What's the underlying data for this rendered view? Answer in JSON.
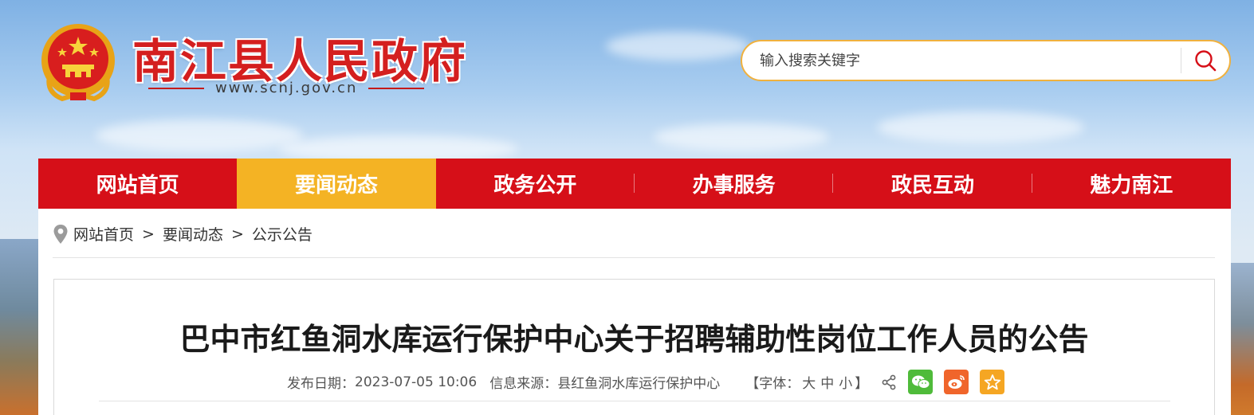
{
  "header": {
    "site_title": "南江县人民政府",
    "site_url": "www.scnj.gov.cn",
    "search_placeholder": "输入搜索关键字"
  },
  "nav": {
    "items": [
      {
        "label": "网站首页",
        "active": false
      },
      {
        "label": "要闻动态",
        "active": true
      },
      {
        "label": "政务公开",
        "active": false
      },
      {
        "label": "办事服务",
        "active": false
      },
      {
        "label": "政民互动",
        "active": false
      },
      {
        "label": "魅力南江",
        "active": false
      }
    ]
  },
  "breadcrumb": {
    "items": [
      "网站首页",
      "要闻动态",
      "公示公告"
    ],
    "separator": ">"
  },
  "article": {
    "title": "巴中市红鱼洞水库运行保护中心关于招聘辅助性岗位工作人员的公告",
    "date_label": "发布日期：",
    "date_value": "2023-07-05 10:06",
    "source_label": "信息来源：",
    "source_value": "县红鱼洞水库运行保护中心",
    "font_label": "【字体：",
    "font_large": "大",
    "font_medium": "中",
    "font_small": "小",
    "font_close": "】"
  },
  "colors": {
    "nav_bg": "#d60f18",
    "nav_active": "#f4b324",
    "title_red": "#d41f1f",
    "search_border": "#f0b13e"
  },
  "icons": {
    "breadcrumb": "location-pin-icon",
    "search": "search-icon",
    "share": "share-icon",
    "wechat": "wechat-icon",
    "weibo": "weibo-icon",
    "favorite": "star-icon"
  }
}
